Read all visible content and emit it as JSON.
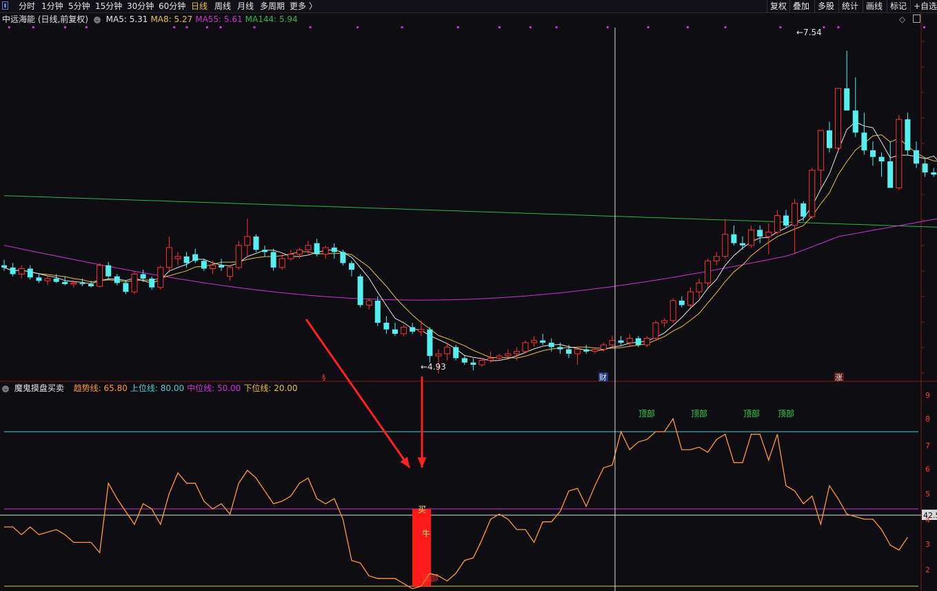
{
  "toolbar": {
    "periods": [
      "分时",
      "1分钟",
      "5分钟",
      "15分钟",
      "30分钟",
      "60分钟",
      "日线",
      "周线",
      "月线",
      "多周期",
      "更多 〉"
    ],
    "active": "日线",
    "right_buttons": [
      "复权",
      "叠加",
      "多股",
      "统计",
      "画线",
      "标记",
      "+自选"
    ]
  },
  "main_legend": {
    "title": "中远海能 (日线,前复权)",
    "items": [
      {
        "label": "MA5: 5.31",
        "color": "#e6e6e6"
      },
      {
        "label": "MA8: 5.27",
        "color": "#e8c23a"
      },
      {
        "label": "MA55: 5.61",
        "color": "#d030d8"
      },
      {
        "label": "MA144: 5.94",
        "color": "#2ab84a"
      }
    ]
  },
  "indicator_legend": {
    "title": "魔鬼摸盘买卖",
    "items": [
      {
        "label": "趋势线: 65.80",
        "color": "#ff9a2e"
      },
      {
        "label": "上位线: 80.00",
        "color": "#4ad0d0"
      },
      {
        "label": "中位线: 50.00",
        "color": "#d030d8"
      },
      {
        "label": "下位线: 20.00",
        "color": "#e8c23a"
      }
    ]
  },
  "annotations": {
    "high_label": "7.54",
    "low_label": "4.93",
    "marker_left": "§",
    "marker_mid": "财",
    "marker_right": "涨",
    "top_labels": [
      "顶部",
      "顶部",
      "顶部",
      "顶部"
    ],
    "buy_label_1": "买",
    "buy_label_2": "牛",
    "bottom_label": "底部",
    "cursor_value": "42.5"
  },
  "colors": {
    "up": "#ff3232",
    "down": "#54f0f0",
    "ma5": "#e6e6e6",
    "ma8": "#e8c23a",
    "ma55": "#d030d8",
    "ma144": "#2ab84a",
    "trend": "#ff9a2e"
  },
  "chart_data": [
    {
      "type": "candlestick",
      "title": "中远海能 (日线,前复权)",
      "ylim": [
        4.6,
        7.75
      ],
      "annotated_high": 7.54,
      "annotated_low": 4.93,
      "series_ma": [
        {
          "name": "MA5",
          "last": 5.31
        },
        {
          "name": "MA8",
          "last": 5.27
        },
        {
          "name": "MA55",
          "last": 5.61
        },
        {
          "name": "MA144",
          "last": 5.94
        }
      ],
      "ohlc": [
        [
          5.6,
          5.65,
          5.55,
          5.58
        ],
        [
          5.58,
          5.62,
          5.5,
          5.52
        ],
        [
          5.52,
          5.6,
          5.48,
          5.57
        ],
        [
          5.57,
          5.6,
          5.47,
          5.49
        ],
        [
          5.49,
          5.53,
          5.44,
          5.46
        ],
        [
          5.46,
          5.51,
          5.42,
          5.48
        ],
        [
          5.48,
          5.52,
          5.44,
          5.45
        ],
        [
          5.45,
          5.5,
          5.42,
          5.43
        ],
        [
          5.43,
          5.47,
          5.4,
          5.44
        ],
        [
          5.44,
          5.48,
          5.41,
          5.43
        ],
        [
          5.43,
          5.46,
          5.4,
          5.41
        ],
        [
          5.41,
          5.62,
          5.4,
          5.6
        ],
        [
          5.6,
          5.63,
          5.48,
          5.5
        ],
        [
          5.5,
          5.52,
          5.42,
          5.44
        ],
        [
          5.44,
          5.46,
          5.34,
          5.36
        ],
        [
          5.36,
          5.55,
          5.34,
          5.52
        ],
        [
          5.52,
          5.56,
          5.45,
          5.48
        ],
        [
          5.48,
          5.5,
          5.38,
          5.4
        ],
        [
          5.4,
          5.6,
          5.38,
          5.58
        ],
        [
          5.58,
          5.86,
          5.55,
          5.76
        ],
        [
          5.66,
          5.72,
          5.6,
          5.68
        ],
        [
          5.68,
          5.72,
          5.58,
          5.62
        ],
        [
          5.7,
          5.75,
          5.62,
          5.64
        ],
        [
          5.64,
          5.66,
          5.55,
          5.57
        ],
        [
          5.57,
          5.64,
          5.52,
          5.6
        ],
        [
          5.6,
          5.66,
          5.55,
          5.58
        ],
        [
          5.5,
          5.6,
          5.46,
          5.58
        ],
        [
          5.58,
          5.82,
          5.56,
          5.78
        ],
        [
          5.78,
          6.02,
          5.68,
          5.86
        ],
        [
          5.86,
          5.88,
          5.72,
          5.74
        ],
        [
          5.74,
          5.78,
          5.68,
          5.72
        ],
        [
          5.72,
          5.75,
          5.55,
          5.58
        ],
        [
          5.58,
          5.7,
          5.56,
          5.66
        ],
        [
          5.66,
          5.74,
          5.64,
          5.7
        ],
        [
          5.7,
          5.76,
          5.66,
          5.74
        ],
        [
          5.74,
          5.82,
          5.7,
          5.78
        ],
        [
          5.8,
          5.84,
          5.68,
          5.7
        ],
        [
          5.7,
          5.78,
          5.66,
          5.76
        ],
        [
          5.76,
          5.8,
          5.66,
          5.72
        ],
        [
          5.72,
          5.74,
          5.6,
          5.62
        ],
        [
          5.62,
          5.64,
          5.5,
          5.56
        ],
        [
          5.5,
          5.52,
          5.22,
          5.24
        ],
        [
          5.24,
          5.3,
          5.2,
          5.28
        ],
        [
          5.28,
          5.32,
          5.05,
          5.08
        ],
        [
          5.08,
          5.14,
          4.98,
          5.02
        ],
        [
          5.02,
          5.08,
          4.96,
          4.98
        ],
        [
          4.98,
          5.06,
          4.96,
          5.04
        ],
        [
          5.04,
          5.08,
          4.98,
          5.0
        ],
        [
          5.0,
          5.1,
          4.96,
          5.02
        ],
        [
          5.02,
          5.04,
          4.72,
          4.78
        ],
        [
          4.78,
          4.84,
          4.62,
          4.8
        ],
        [
          4.8,
          4.9,
          4.74,
          4.86
        ],
        [
          4.86,
          4.88,
          4.74,
          4.76
        ],
        [
          4.76,
          4.78,
          4.7,
          4.72
        ],
        [
          4.72,
          4.76,
          4.65,
          4.7
        ],
        [
          4.7,
          4.76,
          4.68,
          4.74
        ],
        [
          4.74,
          4.82,
          4.72,
          4.76
        ],
        [
          4.76,
          4.8,
          4.74,
          4.78
        ],
        [
          4.78,
          4.84,
          4.76,
          4.8
        ],
        [
          4.8,
          4.86,
          4.74,
          4.82
        ],
        [
          4.82,
          4.92,
          4.8,
          4.9
        ],
        [
          4.9,
          4.96,
          4.86,
          4.92
        ],
        [
          4.92,
          4.98,
          4.88,
          4.9
        ],
        [
          4.9,
          4.94,
          4.82,
          4.86
        ],
        [
          4.86,
          4.9,
          4.8,
          4.84
        ],
        [
          4.84,
          4.88,
          4.76,
          4.8
        ],
        [
          4.8,
          4.86,
          4.7,
          4.84
        ],
        [
          4.84,
          4.88,
          4.8,
          4.82
        ],
        [
          4.82,
          4.86,
          4.8,
          4.84
        ],
        [
          4.84,
          4.9,
          4.82,
          4.88
        ],
        [
          4.88,
          4.96,
          4.86,
          4.92
        ],
        [
          4.92,
          4.96,
          4.88,
          4.9
        ],
        [
          4.9,
          4.98,
          4.86,
          4.94
        ],
        [
          4.94,
          4.96,
          4.86,
          4.88
        ],
        [
          4.88,
          4.96,
          4.86,
          4.94
        ],
        [
          4.94,
          5.1,
          4.92,
          5.08
        ],
        [
          5.08,
          5.12,
          5.04,
          5.1
        ],
        [
          5.1,
          5.3,
          5.08,
          5.28
        ],
        [
          5.28,
          5.32,
          5.22,
          5.24
        ],
        [
          5.24,
          5.4,
          5.22,
          5.36
        ],
        [
          5.36,
          5.48,
          5.3,
          5.44
        ],
        [
          5.44,
          5.66,
          5.4,
          5.64
        ],
        [
          5.64,
          5.72,
          5.6,
          5.68
        ],
        [
          5.68,
          6.02,
          5.66,
          5.88
        ],
        [
          5.88,
          5.96,
          5.78,
          5.8
        ],
        [
          5.8,
          5.86,
          5.74,
          5.78
        ],
        [
          5.78,
          5.96,
          5.76,
          5.92
        ],
        [
          5.92,
          5.96,
          5.8,
          5.86
        ],
        [
          5.86,
          5.98,
          5.7,
          5.9
        ],
        [
          5.9,
          6.1,
          5.88,
          6.05
        ],
        [
          6.05,
          6.1,
          5.94,
          5.96
        ],
        [
          5.96,
          6.2,
          5.7,
          6.16
        ],
        [
          6.16,
          6.18,
          6.0,
          6.04
        ],
        [
          6.04,
          6.48,
          6.02,
          6.46
        ],
        [
          6.46,
          6.6,
          6.3,
          6.82
        ],
        [
          6.82,
          6.9,
          6.62,
          6.66
        ],
        [
          6.66,
          7.06,
          6.62,
          7.2
        ],
        [
          7.2,
          7.54,
          7.0,
          7.0
        ],
        [
          7.0,
          7.3,
          6.76,
          6.8
        ],
        [
          6.8,
          6.98,
          6.6,
          6.64
        ],
        [
          6.64,
          6.72,
          6.5,
          6.58
        ],
        [
          6.58,
          6.62,
          6.4,
          6.54
        ],
        [
          6.54,
          6.72,
          6.34,
          6.3
        ],
        [
          6.3,
          6.96,
          6.28,
          6.92
        ],
        [
          6.92,
          6.98,
          6.6,
          6.64
        ],
        [
          6.64,
          6.72,
          6.48,
          6.52
        ],
        [
          6.52,
          6.56,
          6.4,
          6.44
        ],
        [
          6.44,
          6.48,
          6.4,
          6.42
        ],
        [
          6.42,
          6.52,
          6.34,
          6.5
        ],
        [
          6.5,
          6.52,
          6.36,
          6.38
        ],
        [
          6.38,
          6.44,
          5.84,
          5.9
        ],
        [
          5.9,
          6.0,
          5.8,
          5.82
        ],
        [
          5.72,
          5.92,
          5.7,
          5.88
        ]
      ]
    },
    {
      "type": "line",
      "title": "魔鬼摸盘买卖",
      "ylim": [
        20,
        95
      ],
      "reference_lines": {
        "上位线": 80,
        "中位线": 50,
        "下位线": 20
      },
      "series": [
        {
          "name": "趋势线",
          "last": 65.8,
          "values": [
            43,
            43,
            40,
            43,
            40,
            41,
            42,
            40,
            37,
            37,
            37,
            33,
            60,
            54,
            49,
            44,
            52,
            50,
            44,
            56,
            64,
            60,
            60,
            53,
            50,
            52,
            48,
            60,
            65,
            62,
            57,
            52,
            53,
            55,
            60,
            62,
            54,
            52,
            54,
            46,
            30,
            29,
            24,
            23,
            23,
            23,
            21,
            19,
            20,
            25,
            24,
            22,
            25,
            30,
            31,
            38,
            46,
            48,
            46,
            42,
            42,
            37,
            45,
            45,
            49,
            57,
            58,
            51,
            59,
            66,
            67,
            80,
            73,
            76,
            77,
            80,
            80,
            85,
            73,
            73,
            74,
            72,
            77,
            79,
            68,
            68,
            79,
            79,
            69,
            79,
            59,
            57,
            52,
            55,
            44,
            59,
            54,
            48,
            47,
            46,
            46,
            42,
            36,
            34,
            39
          ]
        }
      ]
    }
  ]
}
